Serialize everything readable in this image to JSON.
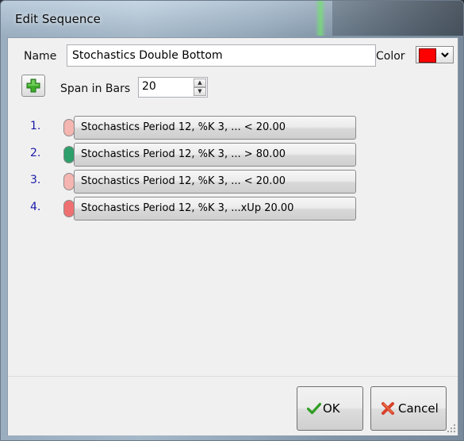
{
  "window": {
    "title": "Edit Sequence"
  },
  "form": {
    "name_label": "Name",
    "name_value": "Stochastics Double Bottom",
    "color_label": "Color",
    "color_value": "#ff0000",
    "span_label": "Span in Bars",
    "span_value": "20"
  },
  "sequence": [
    {
      "number": "1.",
      "label": "Stochastics Period 12, %K 3, ... < 20.00",
      "dot_color": "#f5b5b0"
    },
    {
      "number": "2.",
      "label": "Stochastics Period 12, %K 3, ... > 80.00",
      "dot_color": "#2e9e6a"
    },
    {
      "number": "3.",
      "label": "Stochastics Period 12, %K 3, ... < 20.00",
      "dot_color": "#f5b5b0"
    },
    {
      "number": "4.",
      "label": "Stochastics Period 12, %K 3, ...xUp 20.00",
      "dot_color": "#ef7070"
    }
  ],
  "buttons": {
    "ok_label": "OK",
    "cancel_label": "Cancel"
  },
  "icons": {
    "add": "plus-icon",
    "ok": "checkmark-icon",
    "cancel": "x-icon",
    "color_dropdown": "chevron-down-icon"
  }
}
